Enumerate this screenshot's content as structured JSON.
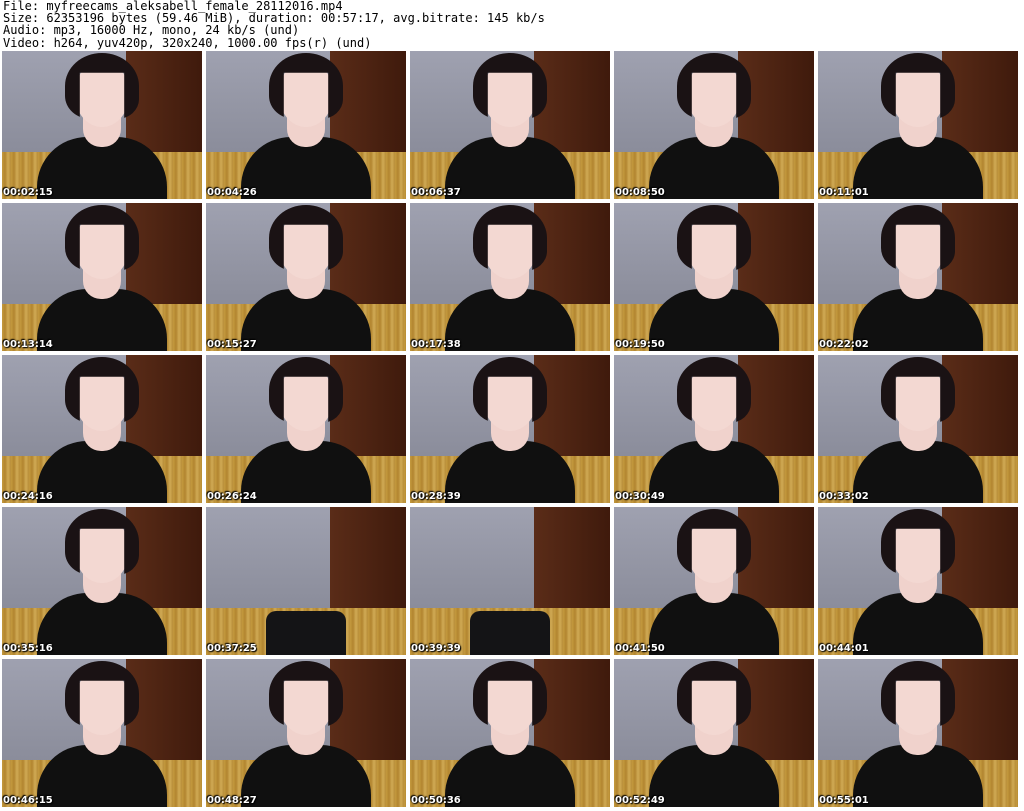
{
  "header": {
    "file_line": "File: myfreecams_aleksabell_female_28112016.mp4",
    "size_line": "Size: 62353196 bytes (59.46 MiB), duration: 00:57:17, avg.bitrate: 145 kb/s",
    "audio_line": "Audio: mp3, 16000 Hz, mono, 24 kb/s (und)",
    "video_line": "Video: h264, yuv420p, 320x240, 1000.00 fps(r) (und)"
  },
  "thumbnails": [
    {
      "timestamp": "00:02:15",
      "empty": false
    },
    {
      "timestamp": "00:04:26",
      "empty": false
    },
    {
      "timestamp": "00:06:37",
      "empty": false
    },
    {
      "timestamp": "00:08:50",
      "empty": false
    },
    {
      "timestamp": "00:11:01",
      "empty": false
    },
    {
      "timestamp": "00:13:14",
      "empty": false
    },
    {
      "timestamp": "00:15:27",
      "empty": false
    },
    {
      "timestamp": "00:17:38",
      "empty": false
    },
    {
      "timestamp": "00:19:50",
      "empty": false
    },
    {
      "timestamp": "00:22:02",
      "empty": false
    },
    {
      "timestamp": "00:24:16",
      "empty": false
    },
    {
      "timestamp": "00:26:24",
      "empty": false
    },
    {
      "timestamp": "00:28:39",
      "empty": false
    },
    {
      "timestamp": "00:30:49",
      "empty": false
    },
    {
      "timestamp": "00:33:02",
      "empty": false
    },
    {
      "timestamp": "00:35:16",
      "empty": false
    },
    {
      "timestamp": "00:37:25",
      "empty": true
    },
    {
      "timestamp": "00:39:39",
      "empty": true
    },
    {
      "timestamp": "00:41:50",
      "empty": false
    },
    {
      "timestamp": "00:44:01",
      "empty": false
    },
    {
      "timestamp": "00:46:15",
      "empty": false
    },
    {
      "timestamp": "00:48:27",
      "empty": false
    },
    {
      "timestamp": "00:50:36",
      "empty": false
    },
    {
      "timestamp": "00:52:49",
      "empty": false
    },
    {
      "timestamp": "00:55:01",
      "empty": false
    }
  ]
}
